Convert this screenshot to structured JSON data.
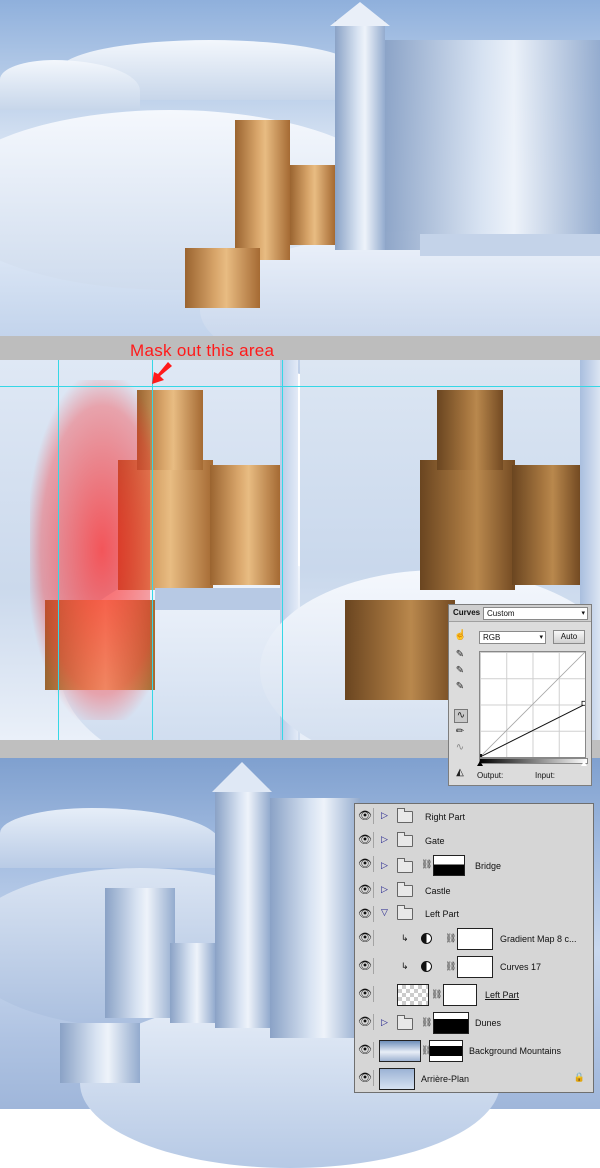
{
  "annotation": {
    "text": "Mask out this area"
  },
  "curves": {
    "title": "Curves",
    "preset": "Custom",
    "channel": "RGB",
    "auto_label": "Auto",
    "output_label": "Output:",
    "input_label": "Input:",
    "curve_points": [
      [
        0,
        0
      ],
      [
        255,
        128
      ]
    ]
  },
  "layers": [
    {
      "name": "Right Part",
      "type": "group",
      "expanded": false
    },
    {
      "name": "Gate",
      "type": "group",
      "expanded": false
    },
    {
      "name": "Bridge",
      "type": "group",
      "expanded": false,
      "has_mask": true
    },
    {
      "name": "Castle",
      "type": "group",
      "expanded": false
    },
    {
      "name": "Left Part",
      "type": "group",
      "expanded": true
    },
    {
      "name": "Gradient Map 8 c...",
      "type": "adjustment",
      "clipped": true
    },
    {
      "name": "Curves 17",
      "type": "adjustment",
      "clipped": true
    },
    {
      "name": "Left Part",
      "type": "layer",
      "has_mask": true
    },
    {
      "name": "Dunes",
      "type": "group",
      "expanded": false,
      "has_mask": true
    },
    {
      "name": "Background Mountains",
      "type": "layer",
      "has_mask": true
    },
    {
      "name": "Arrière-Plan",
      "type": "background",
      "locked": true
    }
  ],
  "colors": {
    "annotation_red": "#ff1a1a",
    "guide_cyan": "#35d7e6"
  }
}
